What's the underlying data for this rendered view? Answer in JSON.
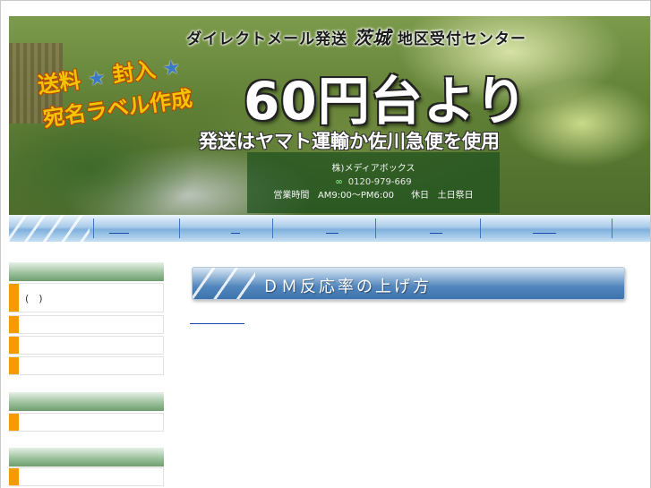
{
  "header": {
    "top_line_prefix": "ダイレクトメール発送",
    "top_line_region": "茨城",
    "top_line_suffix": "地区受付センター",
    "promo_line1_a": "送料",
    "promo_line1_b": "封入",
    "promo_line2": "宛名ラベル作成",
    "headline": "60円台より",
    "subline": "発送はヤマト運輸か佐川急便を使用",
    "company": "株)メディアボックス",
    "freedial_icon": "free-dial-icon",
    "phone": "0120-979-669",
    "hours_label": "営業時間",
    "hours": "AM9:00〜PM6:00",
    "holiday_label": "休日",
    "holidays": "土日祭日"
  },
  "sidebar": {
    "group1_first_item": "(　)"
  },
  "main": {
    "title": "ＤＭ反応率の上げ方"
  },
  "colors": {
    "nav_blue": "#7fb0dc",
    "sidebar_green": "#6e9e70",
    "sidebar_orange": "#f39b00",
    "title_blue": "#3d73ad",
    "link_blue": "#1a46b0"
  }
}
